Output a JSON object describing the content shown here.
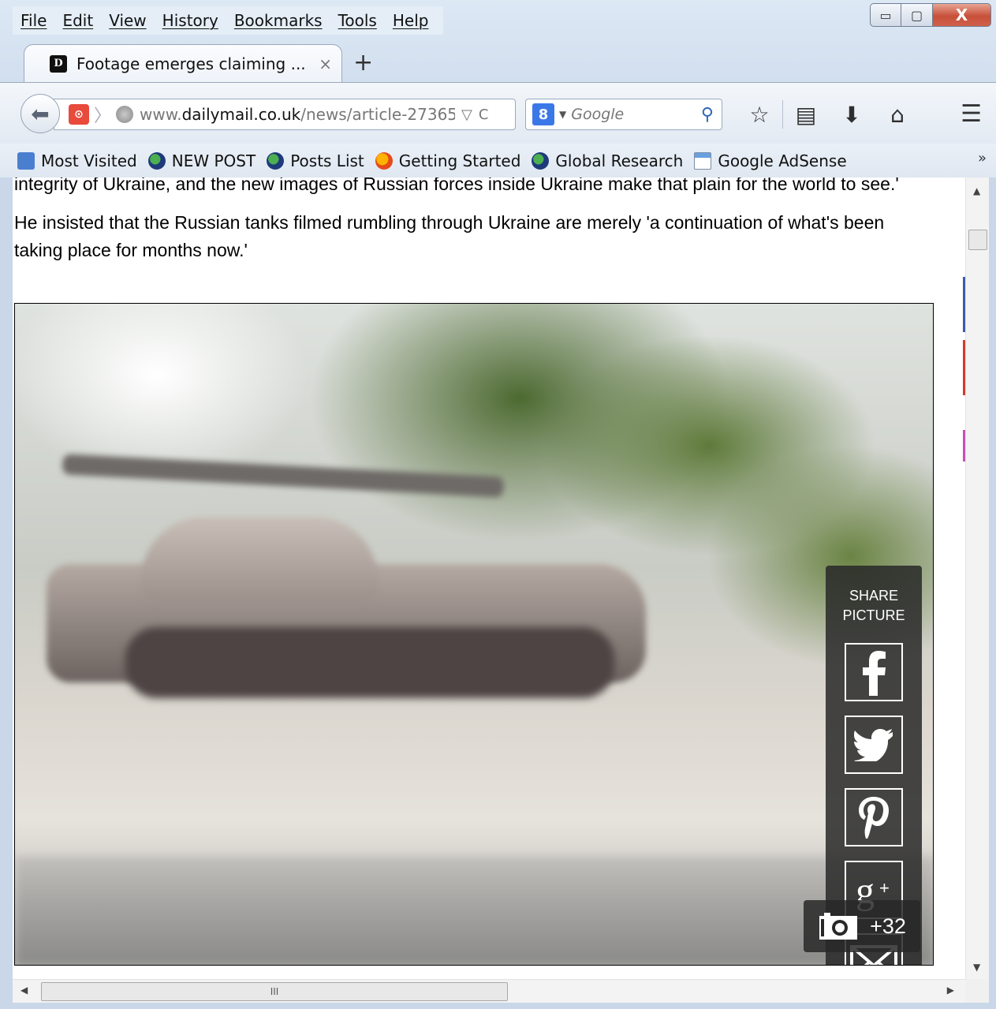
{
  "menu": [
    "File",
    "Edit",
    "View",
    "History",
    "Bookmarks",
    "Tools",
    "Help"
  ],
  "window_controls": {
    "minimize": "▭",
    "maximize": "▢",
    "close": "X"
  },
  "tab": {
    "title": "Footage emerges claiming ...",
    "close": "×",
    "favicon": "D"
  },
  "new_tab_label": "+",
  "urlbar": {
    "prefix": "www.",
    "domain": "dailymail.co.uk",
    "path": "/news/article-27365:"
  },
  "search": {
    "placeholder": "Google",
    "engine": "8"
  },
  "bookmarks": [
    {
      "label": "Most Visited",
      "icon": "blue"
    },
    {
      "label": "NEW POST",
      "icon": "globe"
    },
    {
      "label": "Posts List",
      "icon": "globe"
    },
    {
      "label": "Getting Started",
      "icon": "fx"
    },
    {
      "label": "Global Research",
      "icon": "globe"
    },
    {
      "label": "Google AdSense",
      "icon": "ads"
    }
  ],
  "bookmarks_overflow": "»",
  "article": {
    "p1": "integrity of Ukraine, and the new images of Russian forces inside Ukraine make that plain for the world to see.'",
    "p2": "He insisted that the Russian tanks filmed rumbling through Ukraine are merely 'a continuation of what's been taking place for months now.'"
  },
  "share": {
    "label_line1": "SHARE",
    "label_line2": "PICTURE",
    "buttons": [
      "facebook-icon",
      "twitter-icon",
      "pinterest-icon",
      "google-plus-icon",
      "email-icon"
    ]
  },
  "photo_count": "+32",
  "hscroll_grip": "III",
  "colors": {
    "close_button": "#c7503a",
    "share_panel": "#282828"
  }
}
